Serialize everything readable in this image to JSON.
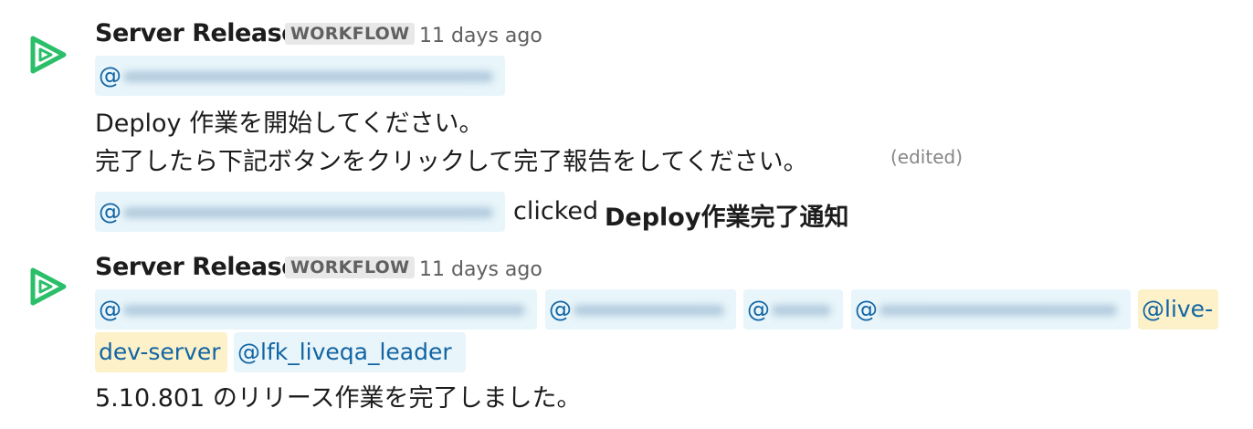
{
  "colors": {
    "workflow_icon": "#2bbf6a",
    "mention_bg": "#e8f5fa",
    "mention_text": "#1264a3",
    "highlight_mention_bg": "#fcf1c8"
  },
  "messages": [
    {
      "icon": "workflow-play-icon",
      "sender": "Server Release",
      "badge": "WORKFLOW",
      "time": "11 days ago",
      "mention_at": "@",
      "line1": "Deploy 作業を開始してください。",
      "line2": "完了したら下記ボタンをクリックして完了報告をしてください。",
      "edited": "(edited)"
    },
    {
      "icon": "workflow-play-icon",
      "sender": "Server Release",
      "badge": "WORKFLOW",
      "time": "11 days ago",
      "mentions": [
        "@",
        "@",
        "@",
        "@"
      ],
      "live_mention_line1": "@live-",
      "live_mention_line2": "dev-server",
      "lfk_mention": "@lfk_liveqa_leader",
      "body": "5.10.801 のリリース作業を完了しました。"
    }
  ],
  "action": {
    "mention_at": "@",
    "clicked_text": "clicked",
    "button_name": "Deploy作業完了通知"
  }
}
